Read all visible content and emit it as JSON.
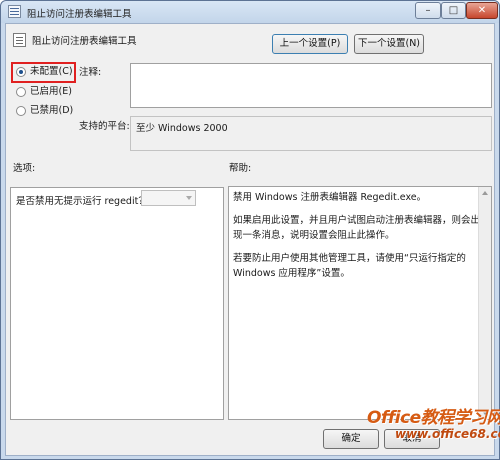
{
  "window": {
    "title": "阻止访问注册表编辑工具",
    "controls": {
      "minimize": "–",
      "maximize": "□",
      "close": "✕"
    }
  },
  "header": {
    "title": "阻止访问注册表编辑工具",
    "prev_button": "上一个设置(P)",
    "next_button": "下一个设置(N)"
  },
  "state": {
    "options": [
      {
        "label": "未配置(C)",
        "selected": true
      },
      {
        "label": "已启用(E)",
        "selected": false
      },
      {
        "label": "已禁用(D)",
        "selected": false
      }
    ]
  },
  "comment": {
    "label": "注释:",
    "value": ""
  },
  "platform": {
    "label": "支持的平台:",
    "value": "至少 Windows 2000"
  },
  "options_panel": {
    "label": "选项:",
    "question": "是否禁用无提示运行 regedit？",
    "select_value": ""
  },
  "help_panel": {
    "label": "帮助:",
    "paragraphs": [
      "禁用 Windows 注册表编辑器 Regedit.exe。",
      "如果启用此设置，并且用户试图启动注册表编辑器，则会出现一条消息，说明设置会阻止此操作。",
      "若要防止用户使用其他管理工具，请使用“只运行指定的 Windows 应用程序”设置。"
    ]
  },
  "footer": {
    "ok_button": "确定",
    "cancel_button": "取消"
  },
  "watermark": {
    "main": "Office教程学习网",
    "url": "www.office68.com"
  },
  "colors": {
    "highlight": "#e02020",
    "watermark": "#d65b13"
  }
}
